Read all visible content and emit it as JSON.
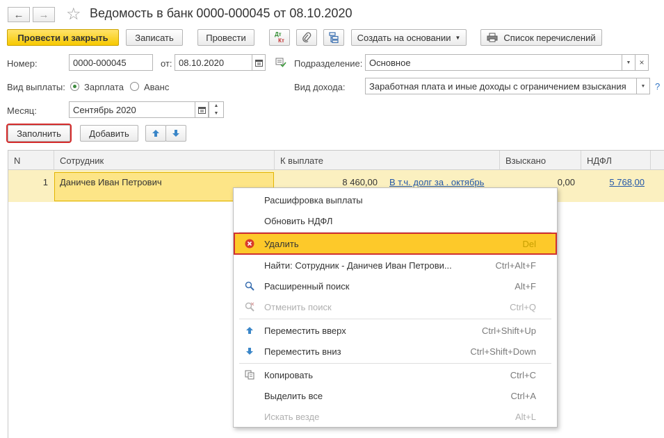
{
  "window": {
    "title": "Ведомость в банк 0000-000045 от 08.10.2020",
    "back_icon": "←",
    "forward_icon": "→",
    "star_icon": "☆"
  },
  "toolbar": {
    "post_close": "Провести и закрыть",
    "save": "Записать",
    "post": "Провести",
    "dt_kt_top": "Дт",
    "dt_kt_bottom": "Кт",
    "create_based": "Создать на основании",
    "transfer_list": "Список перечислений"
  },
  "form": {
    "number_label": "Номер:",
    "number_value": "0000-000045",
    "date_label": "от:",
    "date_value": "08.10.2020",
    "division_label": "Подразделение:",
    "division_value": "Основное",
    "payout_label": "Вид выплаты:",
    "payout_option1": "Зарплата",
    "payout_option2": "Аванс",
    "income_label": "Вид дохода:",
    "income_value": "Заработная плата и иные доходы с ограничением взыскания",
    "help": "?",
    "month_label": "Месяц:",
    "month_value": "Сентябрь 2020"
  },
  "table_toolbar": {
    "fill": "Заполнить",
    "add": "Добавить"
  },
  "table": {
    "headers": [
      "N",
      "Сотрудник",
      "К выплате",
      "Взыскано",
      "НДФЛ"
    ],
    "rows": [
      {
        "n": "1",
        "employee": "Даничев Иван Петрович",
        "to_pay": "8 460,00",
        "debt_link": "В т.ч. долг за . октябрь",
        "withheld": "0,00",
        "ndfl": "5 768,00"
      }
    ]
  },
  "context_menu": {
    "items": [
      {
        "label": "Расшифровка выплаты",
        "shortcut": ""
      },
      {
        "label": "Обновить НДФЛ",
        "shortcut": ""
      },
      {
        "label": "Удалить",
        "shortcut": "Del"
      },
      {
        "label": "Найти: Сотрудник - Даничев Иван Петрови...",
        "shortcut": "Ctrl+Alt+F"
      },
      {
        "label": "Расширенный поиск",
        "shortcut": "Alt+F"
      },
      {
        "label": "Отменить поиск",
        "shortcut": "Ctrl+Q"
      },
      {
        "label": "Переместить вверх",
        "shortcut": "Ctrl+Shift+Up"
      },
      {
        "label": "Переместить вниз",
        "shortcut": "Ctrl+Shift+Down"
      },
      {
        "label": "Копировать",
        "shortcut": "Ctrl+C"
      },
      {
        "label": "Выделить все",
        "shortcut": "Ctrl+A"
      },
      {
        "label": "Искать везде",
        "shortcut": "Alt+L"
      }
    ]
  },
  "colors": {
    "primary_button": "#f7c900",
    "highlight_row": "#fbf0c0",
    "selected_cell": "#fde587",
    "menu_active": "#fdc92a",
    "annotation_red": "#d62b2b",
    "link": "#2357a8"
  }
}
